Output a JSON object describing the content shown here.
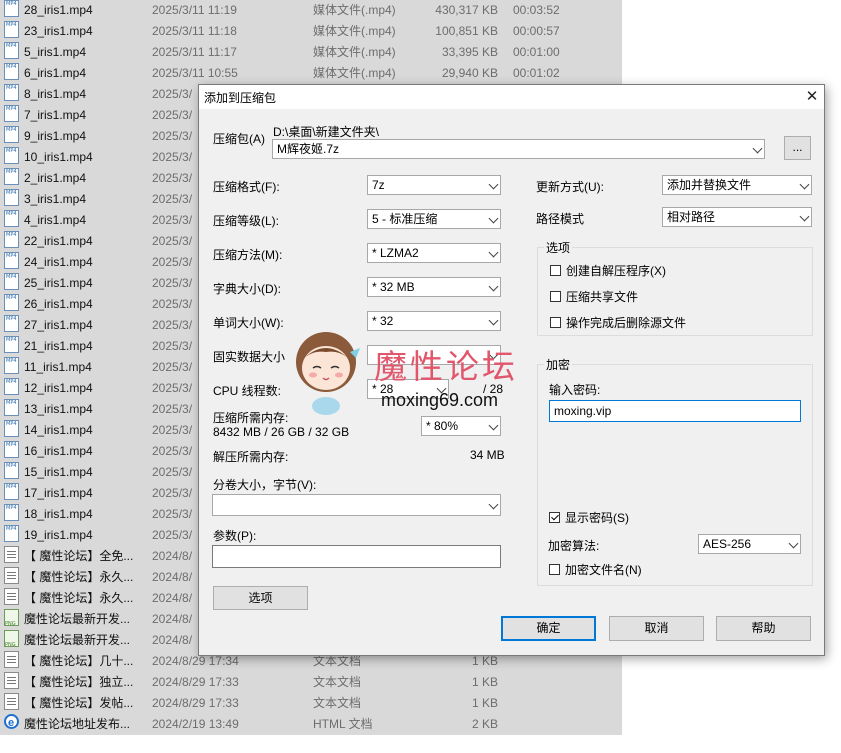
{
  "file_list": [
    {
      "name": "28_iris1.mp4",
      "date": "2025/3/11 11:19",
      "type": "媒体文件(.mp4)",
      "size": "430,317 KB",
      "length": "00:03:52",
      "icon": "mp4"
    },
    {
      "name": "23_iris1.mp4",
      "date": "2025/3/11 11:18",
      "type": "媒体文件(.mp4)",
      "size": "100,851 KB",
      "length": "00:00:57",
      "icon": "mp4"
    },
    {
      "name": "5_iris1.mp4",
      "date": "2025/3/11 11:17",
      "type": "媒体文件(.mp4)",
      "size": "33,395 KB",
      "length": "00:01:00",
      "icon": "mp4"
    },
    {
      "name": "6_iris1.mp4",
      "date": "2025/3/11 10:55",
      "type": "媒体文件(.mp4)",
      "size": "29,940 KB",
      "length": "00:01:02",
      "icon": "mp4"
    },
    {
      "name": "8_iris1.mp4",
      "date": "2025/3/",
      "type": "",
      "size": "",
      "length": "",
      "icon": "mp4"
    },
    {
      "name": "7_iris1.mp4",
      "date": "2025/3/",
      "type": "",
      "size": "",
      "length": "",
      "icon": "mp4"
    },
    {
      "name": "9_iris1.mp4",
      "date": "2025/3/",
      "type": "",
      "size": "",
      "length": "",
      "icon": "mp4"
    },
    {
      "name": "10_iris1.mp4",
      "date": "2025/3/",
      "type": "",
      "size": "",
      "length": "",
      "icon": "mp4"
    },
    {
      "name": "2_iris1.mp4",
      "date": "2025/3/",
      "type": "",
      "size": "",
      "length": "",
      "icon": "mp4"
    },
    {
      "name": "3_iris1.mp4",
      "date": "2025/3/",
      "type": "",
      "size": "",
      "length": "",
      "icon": "mp4"
    },
    {
      "name": "4_iris1.mp4",
      "date": "2025/3/",
      "type": "",
      "size": "",
      "length": "",
      "icon": "mp4"
    },
    {
      "name": "22_iris1.mp4",
      "date": "2025/3/",
      "type": "",
      "size": "",
      "length": "",
      "icon": "mp4"
    },
    {
      "name": "24_iris1.mp4",
      "date": "2025/3/",
      "type": "",
      "size": "",
      "length": "",
      "icon": "mp4"
    },
    {
      "name": "25_iris1.mp4",
      "date": "2025/3/",
      "type": "",
      "size": "",
      "length": "",
      "icon": "mp4"
    },
    {
      "name": "26_iris1.mp4",
      "date": "2025/3/",
      "type": "",
      "size": "",
      "length": "",
      "icon": "mp4"
    },
    {
      "name": "27_iris1.mp4",
      "date": "2025/3/",
      "type": "",
      "size": "",
      "length": "",
      "icon": "mp4"
    },
    {
      "name": "21_iris1.mp4",
      "date": "2025/3/",
      "type": "",
      "size": "",
      "length": "",
      "icon": "mp4"
    },
    {
      "name": "11_iris1.mp4",
      "date": "2025/3/",
      "type": "",
      "size": "",
      "length": "",
      "icon": "mp4"
    },
    {
      "name": "12_iris1.mp4",
      "date": "2025/3/",
      "type": "",
      "size": "",
      "length": "",
      "icon": "mp4"
    },
    {
      "name": "13_iris1.mp4",
      "date": "2025/3/",
      "type": "",
      "size": "",
      "length": "",
      "icon": "mp4"
    },
    {
      "name": "14_iris1.mp4",
      "date": "2025/3/",
      "type": "",
      "size": "",
      "length": "",
      "icon": "mp4"
    },
    {
      "name": "16_iris1.mp4",
      "date": "2025/3/",
      "type": "",
      "size": "",
      "length": "",
      "icon": "mp4"
    },
    {
      "name": "15_iris1.mp4",
      "date": "2025/3/",
      "type": "",
      "size": "",
      "length": "",
      "icon": "mp4"
    },
    {
      "name": "17_iris1.mp4",
      "date": "2025/3/",
      "type": "",
      "size": "",
      "length": "",
      "icon": "mp4"
    },
    {
      "name": "18_iris1.mp4",
      "date": "2025/3/",
      "type": "",
      "size": "",
      "length": "",
      "icon": "mp4"
    },
    {
      "name": "19_iris1.mp4",
      "date": "2025/3/",
      "type": "",
      "size": "",
      "length": "",
      "icon": "mp4"
    },
    {
      "name": "【 魔性论坛】全免...",
      "date": "2024/8/",
      "type": "",
      "size": "",
      "length": "",
      "icon": "txt"
    },
    {
      "name": "【 魔性论坛】永久...",
      "date": "2024/8/",
      "type": "",
      "size": "",
      "length": "",
      "icon": "txt"
    },
    {
      "name": "【 魔性论坛】永久...",
      "date": "2024/8/",
      "type": "",
      "size": "",
      "length": "",
      "icon": "txt"
    },
    {
      "name": "魔性论坛最新开发...",
      "date": "2024/8/",
      "type": "",
      "size": "",
      "length": "",
      "icon": "png"
    },
    {
      "name": "魔性论坛最新开发...",
      "date": "2024/8/",
      "type": "",
      "size": "",
      "length": "",
      "icon": "png"
    },
    {
      "name": "【 魔性论坛】几十...",
      "date": "2024/8/29 17:34",
      "type": "文本文档",
      "size": "1 KB",
      "length": "",
      "icon": "txt"
    },
    {
      "name": "【 魔性论坛】独立...",
      "date": "2024/8/29 17:33",
      "type": "文本文档",
      "size": "1 KB",
      "length": "",
      "icon": "txt"
    },
    {
      "name": "【 魔性论坛】发帖...",
      "date": "2024/8/29 17:33",
      "type": "文本文档",
      "size": "1 KB",
      "length": "",
      "icon": "txt"
    },
    {
      "name": "魔性论坛地址发布...",
      "date": "2024/2/19 13:49",
      "type": "HTML 文档",
      "size": "2 KB",
      "length": "",
      "icon": "html"
    }
  ],
  "dialog": {
    "title": "添加到压缩包",
    "close_glyph": "✕",
    "archive_label": "压缩包(A)",
    "archive_path": "D:\\桌面\\新建文件夹\\",
    "archive_name": "M辉夜姬.7z",
    "browse_label": "...",
    "format_label": "压缩格式(F):",
    "format_value": "7z",
    "level_label": "压缩等级(L):",
    "level_value": "5 - 标准压缩",
    "method_label": "压缩方法(M):",
    "method_value": "* LZMA2",
    "dict_label": "字典大小(D):",
    "dict_value": "* 32 MB",
    "word_label": "单词大小(W):",
    "word_value": "* 32",
    "solid_label": "固实数据大小",
    "cpu_label": "CPU 线程数:",
    "cpu_value": "* 28",
    "cpu_total": "/ 28",
    "mem_comp_label": "压缩所需内存:",
    "mem_comp_value": "8432 MB / 26 GB / 32 GB",
    "mem_pct_value": "* 80%",
    "mem_decomp_label": "解压所需内存:",
    "mem_decomp_value": "34 MB",
    "split_label": "分卷大小，字节(V):",
    "params_label": "参数(P):",
    "options_button": "选项",
    "update_label": "更新方式(U):",
    "update_value": "添加并替换文件",
    "path_label": "路径模式",
    "path_value": "相对路径",
    "options_group_title": "选项",
    "opt_sfx": "创建自解压程序(X)",
    "opt_shared": "压缩共享文件",
    "opt_delete": "操作完成后删除源文件",
    "enc_group_title": "加密",
    "password_label": "输入密码:",
    "password_value": "moxing.vip",
    "show_password": "显示密码(S)",
    "enc_method_label": "加密算法:",
    "enc_method_value": "AES-256",
    "enc_names": "加密文件名(N)",
    "ok": "确定",
    "cancel": "取消",
    "help": "帮助"
  },
  "watermark": {
    "logo_text": "魔性论坛",
    "url": "moxing69.com"
  }
}
